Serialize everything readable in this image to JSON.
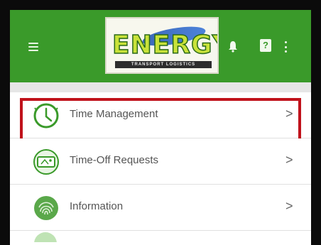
{
  "header": {
    "logo_text": "ENERGY",
    "logo_subtext": "TRANSPORT LOGISTICS",
    "help_glyph": "?",
    "brand_color": "#3a9a2a"
  },
  "menu": {
    "items": [
      {
        "label": "Time Management",
        "icon": "clock-icon",
        "chevron": ">"
      },
      {
        "label": "Time-Off Requests",
        "icon": "ticket-icon",
        "chevron": ">"
      },
      {
        "label": "Information",
        "icon": "fingerprint-icon",
        "chevron": ">"
      }
    ],
    "highlight_color": "#c0121b"
  }
}
